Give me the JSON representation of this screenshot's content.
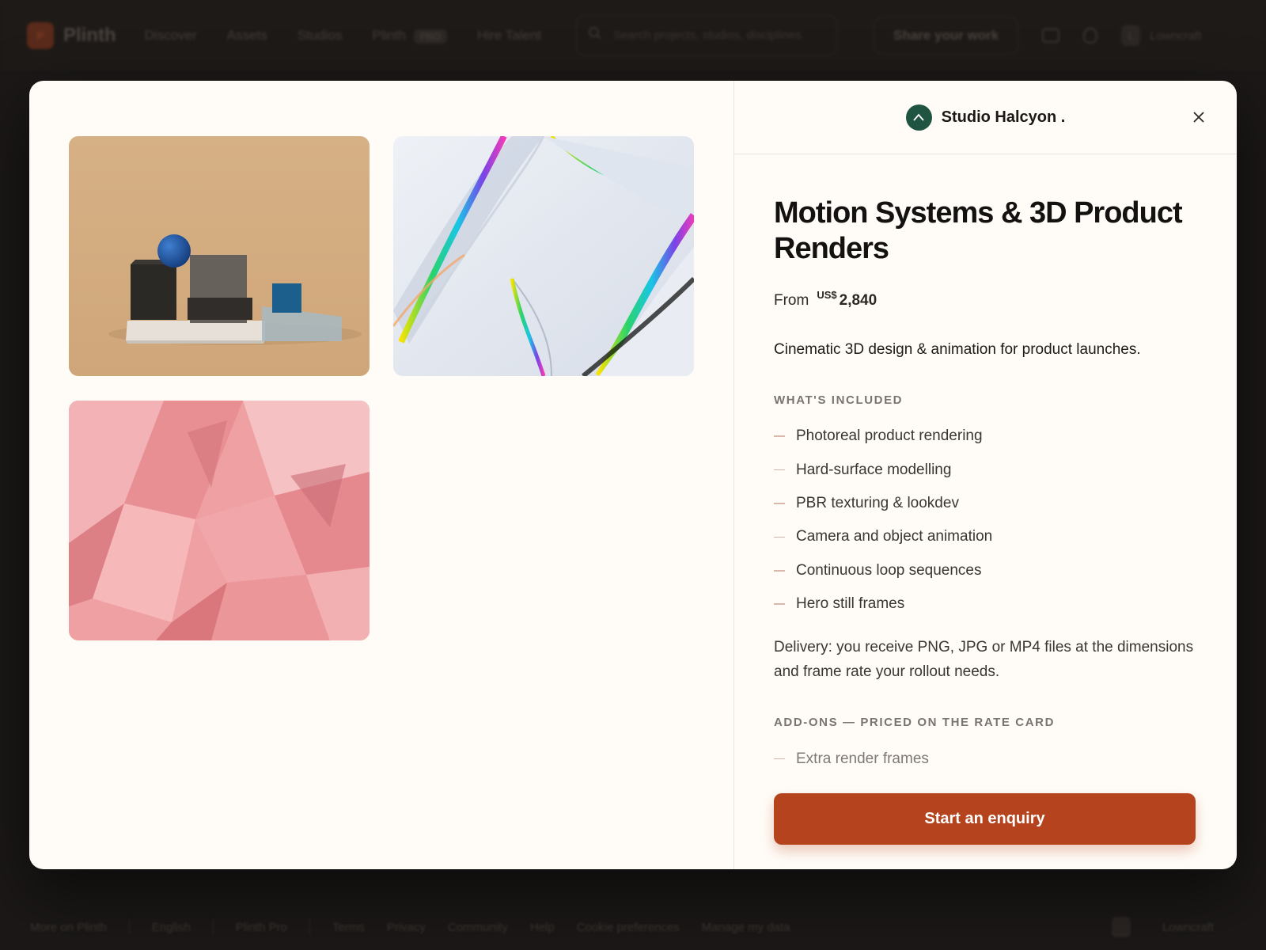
{
  "background": {
    "brand": "Plinth",
    "nav": [
      "Discover",
      "Assets",
      "Studios",
      "Plinth"
    ],
    "nav_pill": "PRO",
    "hire": "Hire Talent",
    "search_placeholder": "Search projects, studios, disciplines",
    "share_label": "Share your work",
    "avatar_initial": "L",
    "user": "Lowncraft",
    "footer": [
      "More on Plinth",
      "English",
      "Plinth Pro",
      "Terms",
      "Privacy",
      "Community",
      "Help",
      "Cookie preferences",
      "Manage my data"
    ],
    "footer_user": "Lowncraft"
  },
  "modal": {
    "studio_name": "Studio Halcyon .",
    "title": "Motion Systems & 3D Product Renders",
    "price_prefix": "From",
    "currency": "US$",
    "price": "2,840",
    "tagline": "Cinematic 3D design & animation for product launches.",
    "included_label": "WHAT'S INCLUDED",
    "included": [
      "Photoreal product rendering",
      "Hard-surface modelling",
      "PBR texturing & lookdev",
      "Camera and object animation",
      "Continuous loop sequences",
      "Hero still frames"
    ],
    "delivery": "Delivery: you receive PNG, JPG or MP4 files at the dimensions and frame rate your rollout needs.",
    "addons_label": "ADD-ONS — PRICED ON THE RATE CARD",
    "addons": [
      "Extra render frames"
    ],
    "cta_label": "Start an enquiry"
  },
  "icons": {
    "close": "close-icon",
    "studio": "chevron-up-icon",
    "search": "search-icon",
    "mail": "mail-icon",
    "bell": "bell-icon"
  },
  "colors": {
    "accent": "#b5441e",
    "studio_badge": "#1f5443",
    "modal_bg": "#fffcf7",
    "backdrop": "#1b1817"
  }
}
